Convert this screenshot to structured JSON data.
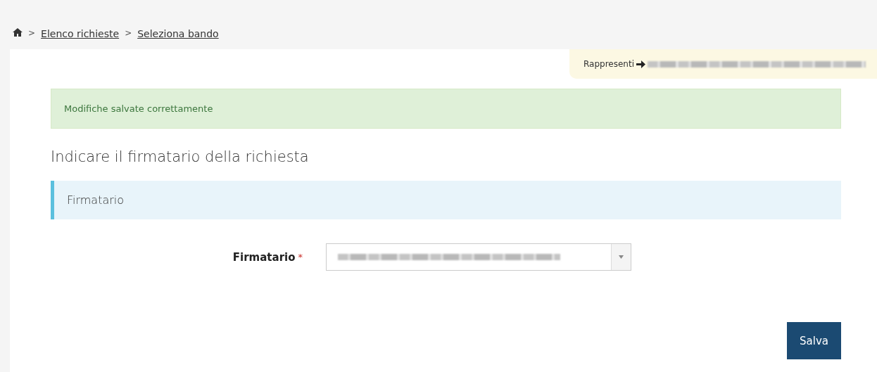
{
  "breadcrumb": [
    {
      "label": "Elenco richieste"
    },
    {
      "label": "Seleziona bando"
    }
  ],
  "breadcrumb_separator": ">",
  "represent": {
    "label": "Rappresenti",
    "value_redacted": true
  },
  "alert": {
    "text": "Modifiche salvate correttamente"
  },
  "heading": "Indicare il firmatario della richiesta",
  "panel": {
    "title": "Firmatario"
  },
  "field": {
    "label": "Firmatario",
    "required": true,
    "required_mark": "*",
    "value_redacted": true
  },
  "buttons": [
    {
      "label": "Salva"
    }
  ]
}
